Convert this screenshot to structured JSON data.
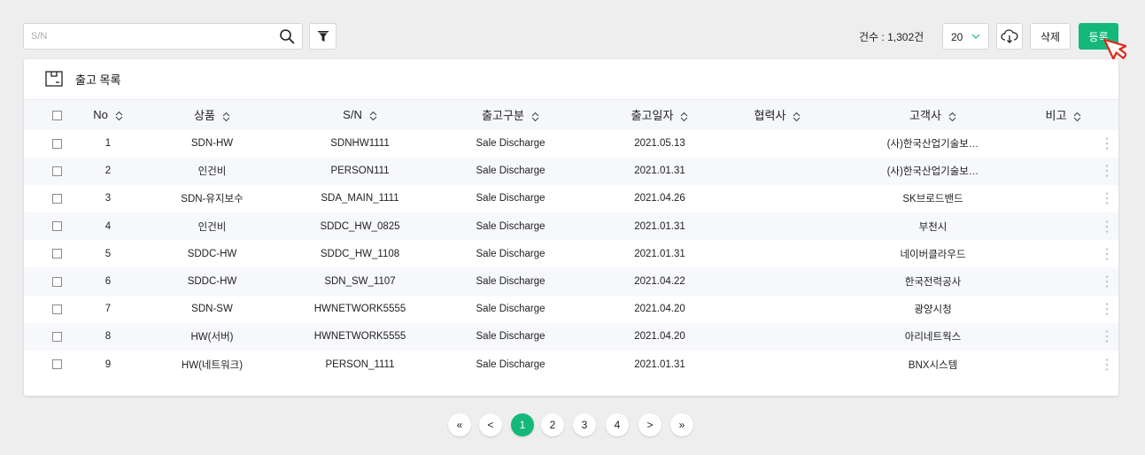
{
  "search": {
    "placeholder": "S/N",
    "value": ""
  },
  "toolbar": {
    "count_label": "건수 : 1,302건",
    "page_size": "20",
    "delete_label": "삭제",
    "register_label": "등록"
  },
  "card": {
    "title": "출고 목록"
  },
  "table": {
    "columns": [
      "No",
      "상품",
      "S/N",
      "출고구분",
      "출고일자",
      "협력사",
      "고객사",
      "비고"
    ],
    "rows": [
      {
        "no": "1",
        "product": "SDN-HW",
        "sn": "SDNHW1111",
        "type": "Sale Discharge",
        "date": "2021.05.13",
        "partner": "",
        "customer": "(사)한국산업기술보…",
        "note": ""
      },
      {
        "no": "2",
        "product": "인건비",
        "sn": "PERSON111",
        "type": "Sale Discharge",
        "date": "2021.01.31",
        "partner": "",
        "customer": "(사)한국산업기술보…",
        "note": ""
      },
      {
        "no": "3",
        "product": "SDN-유지보수",
        "sn": "SDA_MAIN_1111",
        "type": "Sale Discharge",
        "date": "2021.04.26",
        "partner": "",
        "customer": "SK브로드밴드",
        "note": ""
      },
      {
        "no": "4",
        "product": "인건비",
        "sn": "SDDC_HW_0825",
        "type": "Sale Discharge",
        "date": "2021.01.31",
        "partner": "",
        "customer": "부천시",
        "note": ""
      },
      {
        "no": "5",
        "product": "SDDC-HW",
        "sn": "SDDC_HW_1108",
        "type": "Sale Discharge",
        "date": "2021.01.31",
        "partner": "",
        "customer": "네이버클라우드",
        "note": ""
      },
      {
        "no": "6",
        "product": "SDDC-HW",
        "sn": "SDN_SW_1107",
        "type": "Sale Discharge",
        "date": "2021.04.22",
        "partner": "",
        "customer": "한국전력공사",
        "note": ""
      },
      {
        "no": "7",
        "product": "SDN-SW",
        "sn": "HWNETWORK5555",
        "type": "Sale Discharge",
        "date": "2021.04.20",
        "partner": "",
        "customer": "광양시청",
        "note": ""
      },
      {
        "no": "8",
        "product": "HW(서버)",
        "sn": "HWNETWORK5555",
        "type": "Sale Discharge",
        "date": "2021.04.20",
        "partner": "",
        "customer": "아리네트웍스",
        "note": ""
      },
      {
        "no": "9",
        "product": "HW(네트워크)",
        "sn": "PERSON_1111",
        "type": "Sale Discharge",
        "date": "2021.01.31",
        "partner": "",
        "customer": "BNX시스템",
        "note": ""
      }
    ]
  },
  "pagination": {
    "first": "«",
    "prev": "<",
    "pages": [
      "1",
      "2",
      "3",
      "4"
    ],
    "current": "1",
    "next": ">",
    "last": "»"
  },
  "colors": {
    "accent": "#13b87a"
  }
}
